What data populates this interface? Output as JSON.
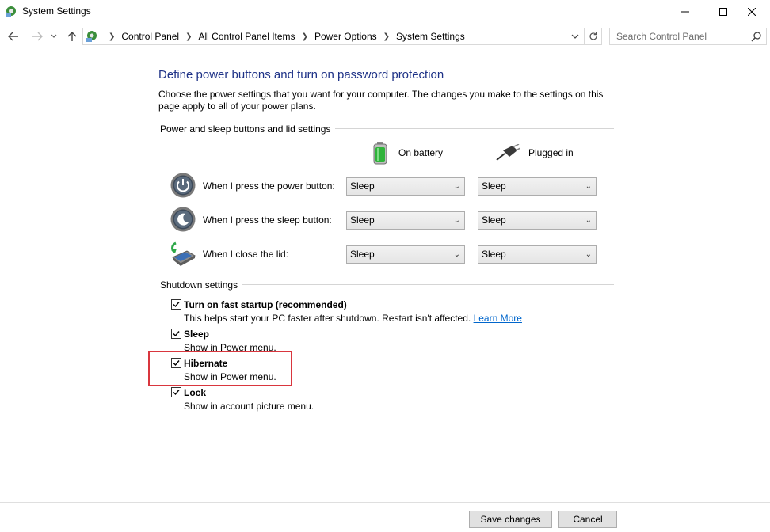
{
  "window": {
    "title": "System Settings"
  },
  "nav": {
    "breadcrumbs": [
      "Control Panel",
      "All Control Panel Items",
      "Power Options",
      "System Settings"
    ],
    "search_placeholder": "Search Control Panel"
  },
  "content": {
    "heading": "Define power buttons and turn on password protection",
    "description": "Choose the power settings that you want for your computer. The changes you make to the settings on this page apply to all of your power plans."
  },
  "power_section": {
    "title": "Power and sleep buttons and lid settings",
    "columns": {
      "battery": "On battery",
      "plugged": "Plugged in"
    },
    "rows": [
      {
        "label": "When I press the power button:",
        "battery": "Sleep",
        "plugged": "Sleep"
      },
      {
        "label": "When I press the sleep button:",
        "battery": "Sleep",
        "plugged": "Sleep"
      },
      {
        "label": "When I close the lid:",
        "battery": "Sleep",
        "plugged": "Sleep"
      }
    ]
  },
  "shutdown_section": {
    "title": "Shutdown settings",
    "options": [
      {
        "title": "Turn on fast startup (recommended)",
        "sub": "This helps start your PC faster after shutdown. Restart isn't affected.",
        "link": "Learn More",
        "checked": true
      },
      {
        "title": "Sleep",
        "sub": "Show in Power menu.",
        "checked": true
      },
      {
        "title": "Hibernate",
        "sub": "Show in Power menu.",
        "checked": true
      },
      {
        "title": "Lock",
        "sub": "Show in account picture menu.",
        "checked": true
      }
    ]
  },
  "footer": {
    "save": "Save changes",
    "cancel": "Cancel"
  },
  "colors": {
    "heading": "#1e3287",
    "link": "#0066cc",
    "highlight": "#d9363e"
  }
}
